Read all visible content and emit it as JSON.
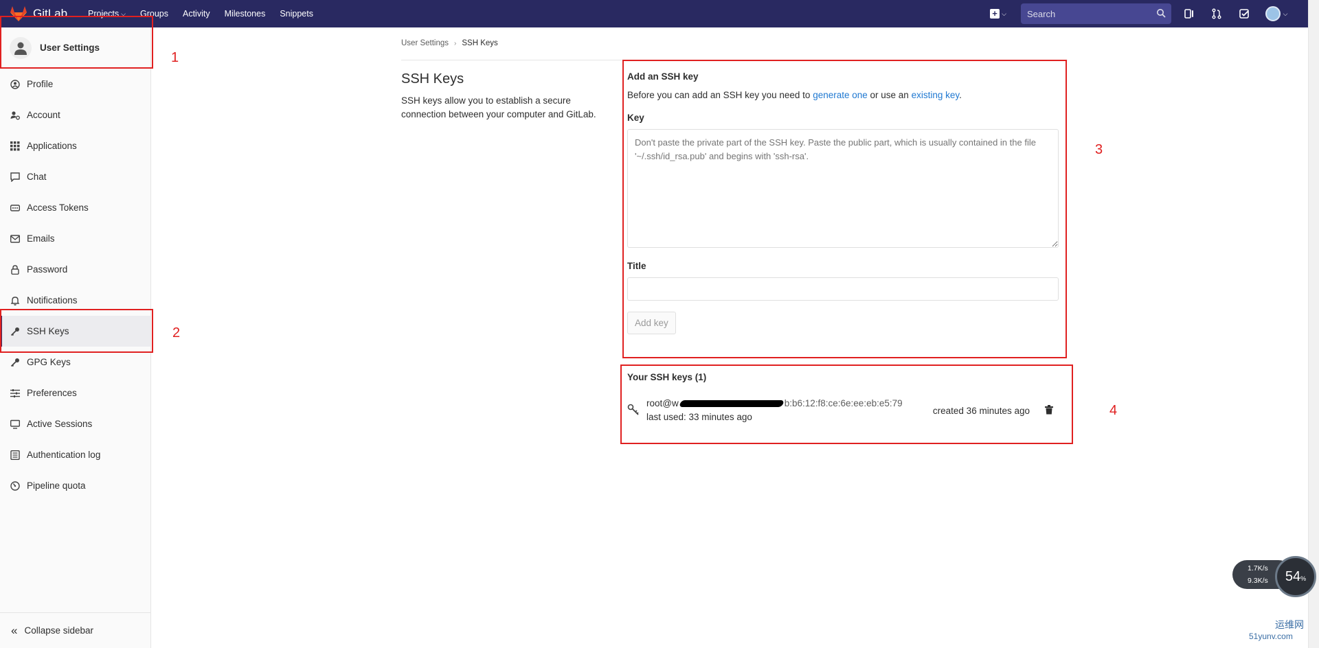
{
  "navbar": {
    "brand": "GitLab",
    "links": [
      {
        "label": "Projects",
        "dropdown": true
      },
      {
        "label": "Groups",
        "dropdown": false
      },
      {
        "label": "Activity",
        "dropdown": false
      },
      {
        "label": "Milestones",
        "dropdown": false
      },
      {
        "label": "Snippets",
        "dropdown": false
      }
    ],
    "search_placeholder": "Search",
    "colors": {
      "bar": "#292961",
      "search_bg": "#474792"
    }
  },
  "sidebar": {
    "header": "User Settings",
    "items": [
      {
        "label": "Profile",
        "icon": "profile-icon"
      },
      {
        "label": "Account",
        "icon": "account-icon"
      },
      {
        "label": "Applications",
        "icon": "applications-icon"
      },
      {
        "label": "Chat",
        "icon": "chat-icon"
      },
      {
        "label": "Access Tokens",
        "icon": "token-icon"
      },
      {
        "label": "Emails",
        "icon": "email-icon"
      },
      {
        "label": "Password",
        "icon": "lock-icon"
      },
      {
        "label": "Notifications",
        "icon": "bell-icon"
      },
      {
        "label": "SSH Keys",
        "icon": "key-icon",
        "active": true
      },
      {
        "label": "GPG Keys",
        "icon": "key-icon"
      },
      {
        "label": "Preferences",
        "icon": "sliders-icon"
      },
      {
        "label": "Active Sessions",
        "icon": "monitor-icon"
      },
      {
        "label": "Authentication log",
        "icon": "log-icon"
      },
      {
        "label": "Pipeline quota",
        "icon": "gauge-icon"
      }
    ],
    "collapse_label": "Collapse sidebar"
  },
  "breadcrumb": {
    "parent": "User Settings",
    "current": "SSH Keys"
  },
  "intro": {
    "title": "SSH Keys",
    "description": "SSH keys allow you to establish a secure connection between your computer and GitLab."
  },
  "form": {
    "heading": "Add an SSH key",
    "intro_before": "Before you can add an SSH key you need to ",
    "link_generate": "generate one",
    "intro_middle": " or use an ",
    "link_existing": "existing key",
    "intro_after": ".",
    "key_label": "Key",
    "key_placeholder": "Don't paste the private part of the SSH key. Paste the public part, which is usually contained in the file '~/.ssh/id_rsa.pub' and begins with 'ssh-rsa'.",
    "title_label": "Title",
    "title_value": "",
    "submit_label": "Add key"
  },
  "keys": {
    "heading": "Your SSH keys (1)",
    "items": [
      {
        "title_prefix": "root@w",
        "fingerprint_suffix": "b:b6:12:f8:ce:6e:ee:eb:e5:79",
        "last_used": "last used: 33 minutes ago",
        "created": "created 36 minutes ago"
      }
    ]
  },
  "annotations": [
    "1",
    "2",
    "3",
    "4"
  ],
  "speed_widget": {
    "up": "1.7K/s",
    "down": "9.3K/s",
    "percent": "54",
    "unit": "%"
  },
  "watermark": {
    "line1": "运维网",
    "line2": "51yunv.com"
  }
}
